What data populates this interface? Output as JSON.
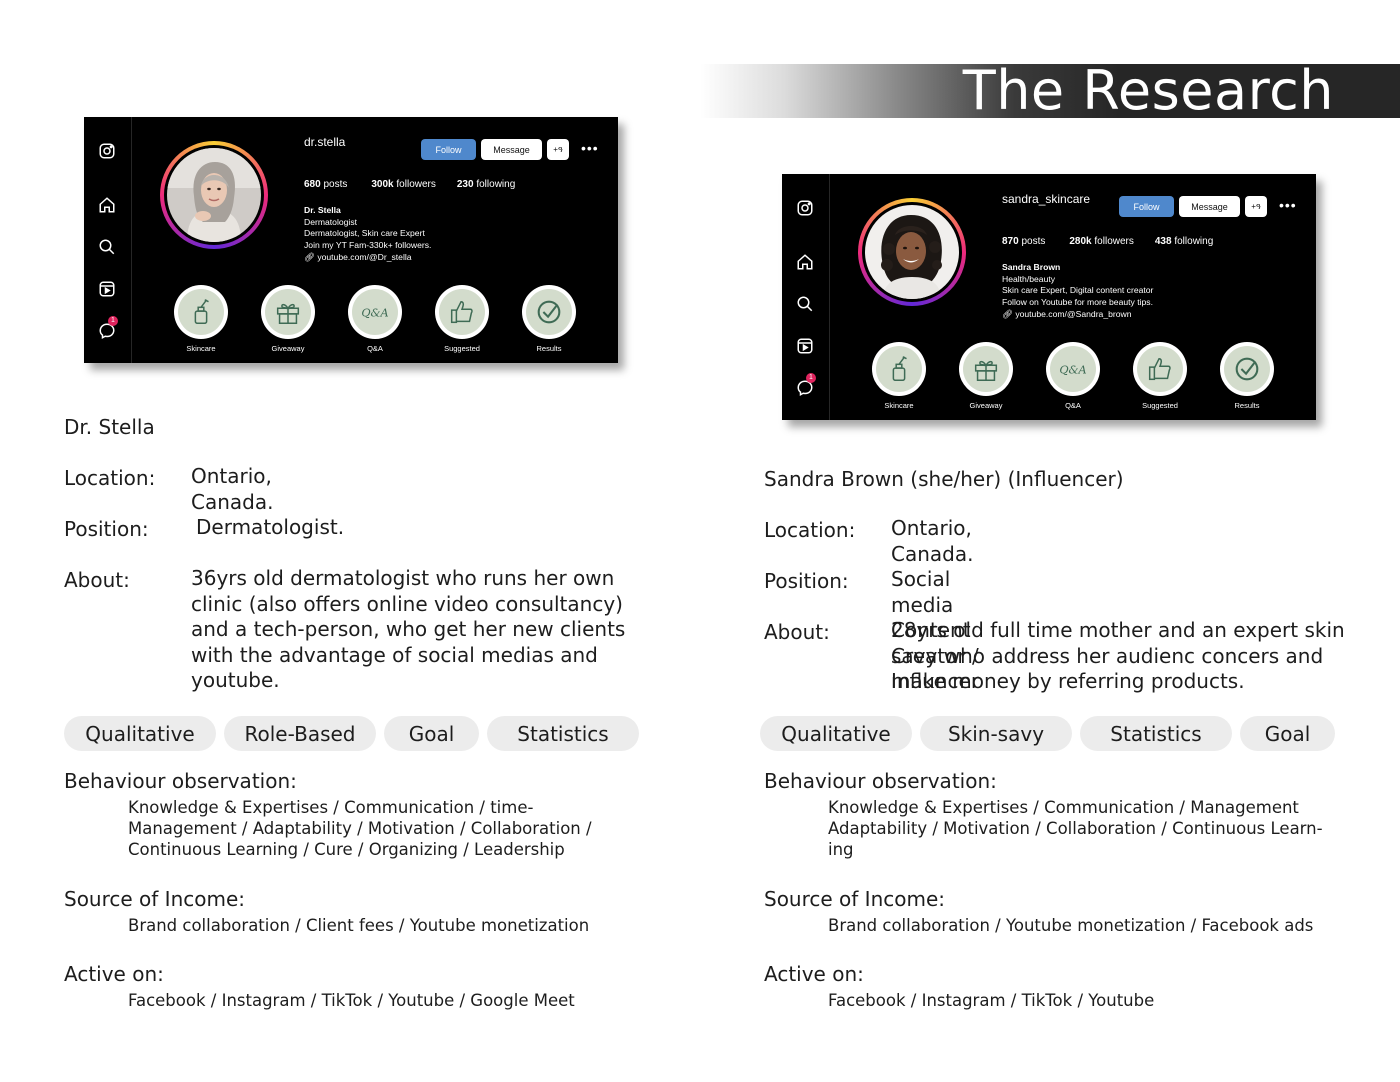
{
  "header": {
    "title": "The Research"
  },
  "profiles": [
    {
      "username": "dr.stella",
      "follow_label": "Follow",
      "message_label": "Message",
      "adduser_label": "+ዓ",
      "more_label": "•••",
      "posts": "680",
      "posts_label": "posts",
      "followers": "300k",
      "followers_label": "followers",
      "following": "230",
      "following_label": "following",
      "bio_name": "Dr. Stella",
      "bio_lines": [
        "Dermatologist",
        "Dermatologist, Skin care Expert",
        "Join my YT Fam-330k+ followers."
      ],
      "link": "youtube.com/@Dr_stella",
      "notif_count": "1",
      "highlights": [
        "Skincare",
        "Giveaway",
        "Q&A",
        "Suggested",
        "Results"
      ],
      "highlight_icons": [
        "dropper-bottle-icon",
        "gift-icon",
        "qa-icon",
        "thumbs-up-icon",
        "check-icon"
      ]
    },
    {
      "username": "sandra_skincare",
      "follow_label": "Follow",
      "message_label": "Message",
      "adduser_label": "+ዓ",
      "more_label": "•••",
      "posts": "870",
      "posts_label": "posts",
      "followers": "280k",
      "followers_label": "followers",
      "following": "438",
      "following_label": "following",
      "bio_name": "Sandra Brown",
      "bio_lines": [
        "Health/beauty",
        "Skin care Expert, Digital content creator",
        "Follow on Youtube for more beauty tips."
      ],
      "link": "youtube.com/@Sandra_brown",
      "notif_count": "1",
      "highlights": [
        "Skincare",
        "Giveaway",
        "Q&A",
        "Suggested",
        "Results"
      ],
      "highlight_icons": [
        "dropper-bottle-icon",
        "gift-icon",
        "qa-icon",
        "thumbs-up-icon",
        "check-icon"
      ]
    }
  ],
  "personas": [
    {
      "name": "Dr. Stella",
      "location_label": "Location:",
      "location": "Ontario, Canada.",
      "position_label": "Position:",
      "position": "Dermatologist.",
      "about_label": "About:",
      "about_lines": [
        "36yrs old dermatologist who runs her own",
        "clinic (also offers online video consultancy)",
        "and a tech-person, who get her new clients",
        "with the advantage of social medias and",
        "youtube."
      ],
      "tags": [
        "Qualitative",
        "Role-Based",
        "Goal",
        "Statistics"
      ],
      "behaviour_title": "Behaviour observation:",
      "behaviour_lines": [
        "Knowledge & Expertises / Communication / time-",
        "Management / Adaptability / Motivation / Collaboration /",
        "Continuous Learning / Cure / Organizing / Leadership"
      ],
      "income_title": "Source of Income:",
      "income": "Brand collaboration / Client fees / Youtube monetization",
      "active_title": "Active on:",
      "active": "Facebook / Instagram / TikTok / Youtube / Google Meet"
    },
    {
      "name": "Sandra Brown (she/her) (Influencer)",
      "location_label": "Location:",
      "location": "Ontario, Canada.",
      "position_label": "Position:",
      "position": "Social media Content Creator / Influncer",
      "about_label": "About:",
      "about_lines": [
        "28yrs old full time mother and an expert skin",
        "savy who address her audienc concers and",
        "make money by referring products."
      ],
      "tags": [
        "Qualitative",
        "Skin-savy",
        "Statistics",
        "Goal"
      ],
      "behaviour_title": "Behaviour observation:",
      "behaviour_lines": [
        "Knowledge & Expertises / Communication / Management",
        "Adaptability / Motivation / Collaboration / Continuous Learn-",
        "ing"
      ],
      "income_title": "Source of Income:",
      "income": "Brand collaboration / Youtube monetization / Facebook ads",
      "active_title": "Active on:",
      "active": "Facebook / Instagram / TikTok / Youtube"
    }
  ]
}
